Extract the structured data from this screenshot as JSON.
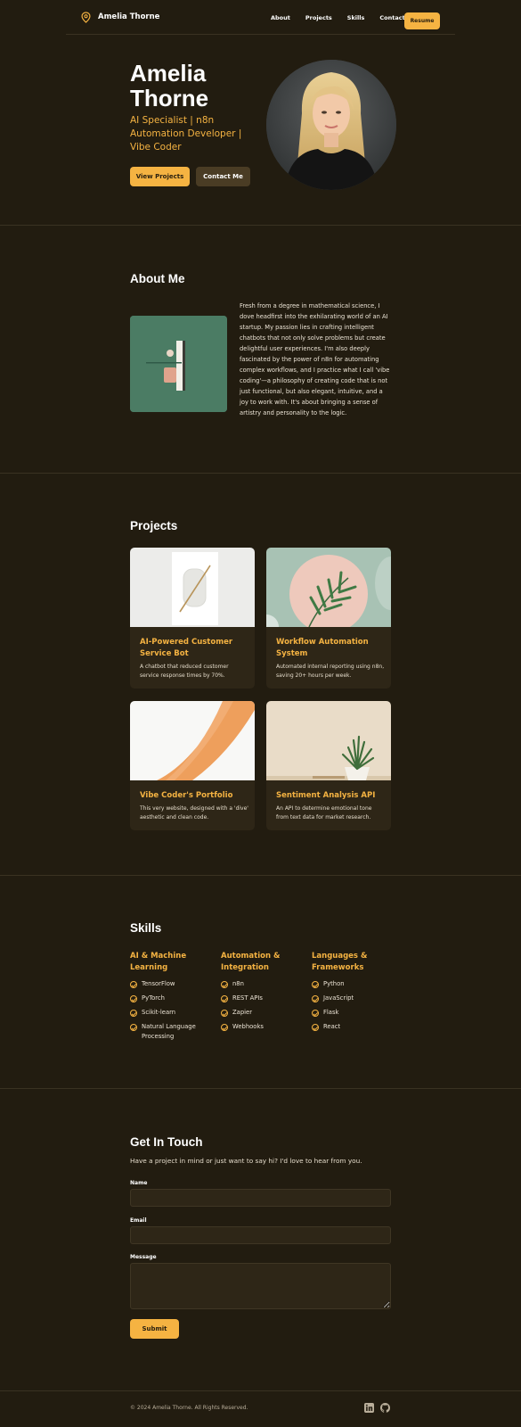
{
  "header": {
    "logo_text": "Amelia Thorne",
    "nav": [
      "About",
      "Projects",
      "Skills",
      "Contact"
    ],
    "resume_label": "Resume"
  },
  "hero": {
    "name_line1": "Amelia",
    "name_line2": "Thorne",
    "subtitle": "AI Specialist | n8n Automation Developer | Vibe Coder",
    "primary_button": "View Projects",
    "secondary_button": "Contact Me"
  },
  "about": {
    "title": "About Me",
    "text": "Fresh from a degree in mathematical science, I dove headfirst into the exhilarating world of an AI startup. My passion lies in crafting intelligent chatbots that not only solve problems but create delightful user experiences. I'm also deeply fascinated by the power of n8n for automating complex workflows, and I practice what I call 'vibe coding'—a philosophy of creating code that is not just functional, but also elegant, intuitive, and a joy to work with. It's about bringing a sense of artistry and personality to the logic."
  },
  "projects": {
    "title": "Projects",
    "items": [
      {
        "title": "AI-Powered Customer Service Bot",
        "desc": "A chatbot that reduced customer service response times by 70%."
      },
      {
        "title": "Workflow Automation System",
        "desc": "Automated internal reporting using n8n, saving 20+ hours per week."
      },
      {
        "title": "Vibe Coder's Portfolio",
        "desc": "This very website, designed with a 'dive' aesthetic and clean code."
      },
      {
        "title": "Sentiment Analysis API",
        "desc": "An API to determine emotional tone from text data for market research."
      }
    ]
  },
  "skills": {
    "title": "Skills",
    "groups": [
      {
        "title": "AI & Machine Learning",
        "items": [
          "TensorFlow",
          "PyTorch",
          "Scikit-learn",
          "Natural Language Processing"
        ]
      },
      {
        "title": "Automation & Integration",
        "items": [
          "n8n",
          "REST APIs",
          "Zapier",
          "Webhooks"
        ]
      },
      {
        "title": "Languages & Frameworks",
        "items": [
          "Python",
          "JavaScript",
          "Flask",
          "React"
        ]
      }
    ]
  },
  "contact": {
    "title": "Get In Touch",
    "lead": "Have a project in mind or just want to say hi? I'd love to hear from you.",
    "name_label": "Name",
    "email_label": "Email",
    "message_label": "Message",
    "submit_label": "Submit"
  },
  "footer": {
    "copyright": "© 2024 Amelia Thorne. All Rights Reserved.",
    "icons": [
      "linkedin-icon",
      "github-icon"
    ]
  },
  "colors": {
    "background": "#221c10",
    "accent": "#f5b342",
    "card": "#2e2617"
  }
}
